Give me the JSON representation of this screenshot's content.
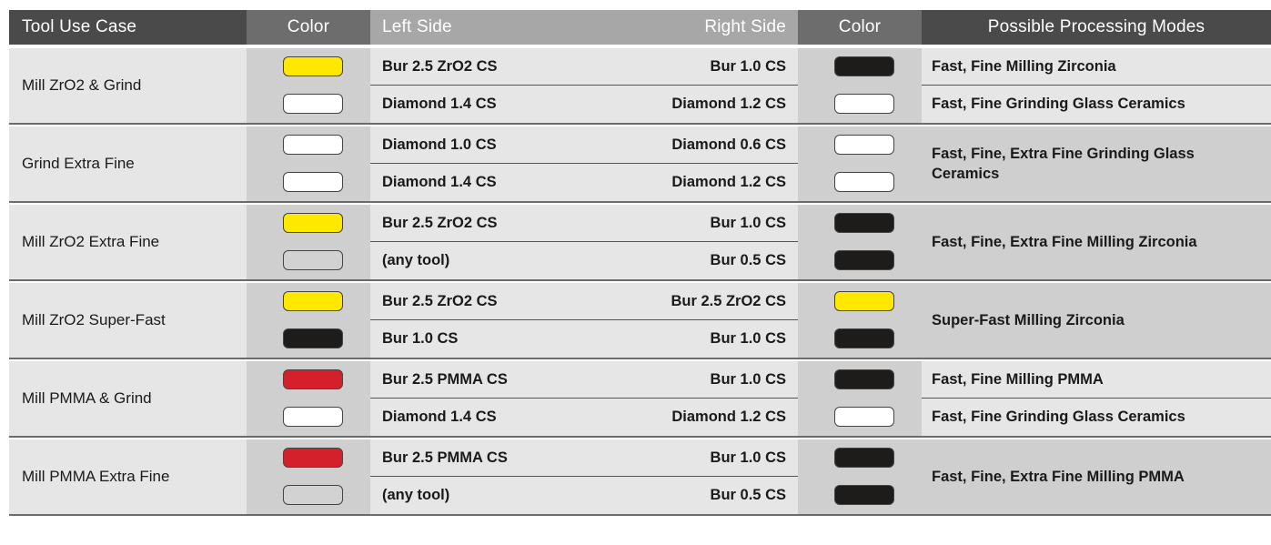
{
  "header": {
    "tool_use_case": "Tool Use Case",
    "color_left": "Color",
    "left_side": "Left Side",
    "right_side": "Right Side",
    "color_right": "Color",
    "modes": "Possible Processing Modes"
  },
  "palette": {
    "yellow": "#ffe800",
    "white": "#ffffff",
    "black": "#1e1b1b",
    "red": "#d4202a",
    "gray": "#d2d2d2"
  },
  "rows": [
    {
      "case": "Mill ZrO2 & Grind",
      "left_colors": [
        "yellow",
        "white"
      ],
      "tools": [
        {
          "left": "Bur 2.5 ZrO2 CS",
          "right": "Bur 1.0 CS"
        },
        {
          "left": "Diamond 1.4 CS",
          "right": "Diamond 1.2 CS"
        }
      ],
      "right_colors": [
        "black",
        "white"
      ],
      "modes": [
        "Fast, Fine Milling Zirconia",
        "Fast, Fine Grinding Glass Ceramics"
      ]
    },
    {
      "case": "Grind Extra Fine",
      "left_colors": [
        "white",
        "white"
      ],
      "tools": [
        {
          "left": "Diamond 1.0 CS",
          "right": "Diamond 0.6 CS"
        },
        {
          "left": "Diamond 1.4 CS",
          "right": "Diamond 1.2 CS"
        }
      ],
      "right_colors": [
        "white",
        "white"
      ],
      "modes": [
        "Fast, Fine, Extra Fine Grinding Glass Ceramics"
      ]
    },
    {
      "case": "Mill ZrO2 Extra Fine",
      "left_colors": [
        "yellow",
        "gray"
      ],
      "tools": [
        {
          "left": "Bur 2.5 ZrO2 CS",
          "right": "Bur 1.0 CS"
        },
        {
          "left": "(any tool)",
          "right": "Bur 0.5 CS"
        }
      ],
      "right_colors": [
        "black",
        "black"
      ],
      "modes": [
        "Fast, Fine, Extra Fine Milling Zirconia"
      ]
    },
    {
      "case": "Mill ZrO2 Super-Fast",
      "left_colors": [
        "yellow",
        "black"
      ],
      "tools": [
        {
          "left": "Bur 2.5 ZrO2 CS",
          "right": "Bur 2.5 ZrO2 CS"
        },
        {
          "left": "Bur 1.0 CS",
          "right": "Bur 1.0 CS"
        }
      ],
      "right_colors": [
        "yellow",
        "black"
      ],
      "modes": [
        "Super-Fast Milling Zirconia"
      ]
    },
    {
      "case": "Mill PMMA & Grind",
      "left_colors": [
        "red",
        "white"
      ],
      "tools": [
        {
          "left": "Bur 2.5 PMMA CS",
          "right": "Bur 1.0 CS"
        },
        {
          "left": "Diamond 1.4 CS",
          "right": "Diamond 1.2 CS"
        }
      ],
      "right_colors": [
        "black",
        "white"
      ],
      "modes": [
        "Fast, Fine Milling PMMA",
        "Fast, Fine Grinding Glass Ceramics"
      ]
    },
    {
      "case": "Mill PMMA Extra Fine",
      "left_colors": [
        "red",
        "gray"
      ],
      "tools": [
        {
          "left": "Bur 2.5 PMMA CS",
          "right": "Bur 1.0 CS"
        },
        {
          "left": "(any tool)",
          "right": "Bur 0.5 CS"
        }
      ],
      "right_colors": [
        "black",
        "black"
      ],
      "modes": [
        "Fast, Fine, Extra Fine Milling PMMA"
      ]
    }
  ]
}
